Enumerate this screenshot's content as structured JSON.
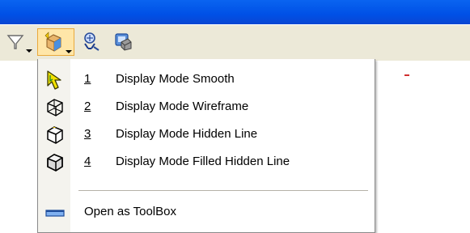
{
  "window": {
    "titlebar_color": "#0a5af0"
  },
  "toolbar": {
    "buttons": [
      {
        "icon": "filter-icon"
      },
      {
        "icon": "display-mode-icon",
        "active": true
      },
      {
        "icon": "inspect-icon"
      },
      {
        "icon": "render-icon"
      }
    ]
  },
  "menu": {
    "items": [
      {
        "accel": "1",
        "label": "Display Mode Smooth",
        "icon": "smooth-cursor-icon"
      },
      {
        "accel": "2",
        "label": "Display Mode Wireframe",
        "icon": "wireframe-cube-icon"
      },
      {
        "accel": "3",
        "label": "Display Mode Hidden Line",
        "icon": "hidden-line-cube-icon"
      },
      {
        "accel": "4",
        "label": "Display Mode Filled Hidden Line",
        "icon": "filled-hidden-line-cube-icon"
      }
    ],
    "toolbox": {
      "label": "Open as ToolBox",
      "icon": "toolbox-icon"
    }
  }
}
